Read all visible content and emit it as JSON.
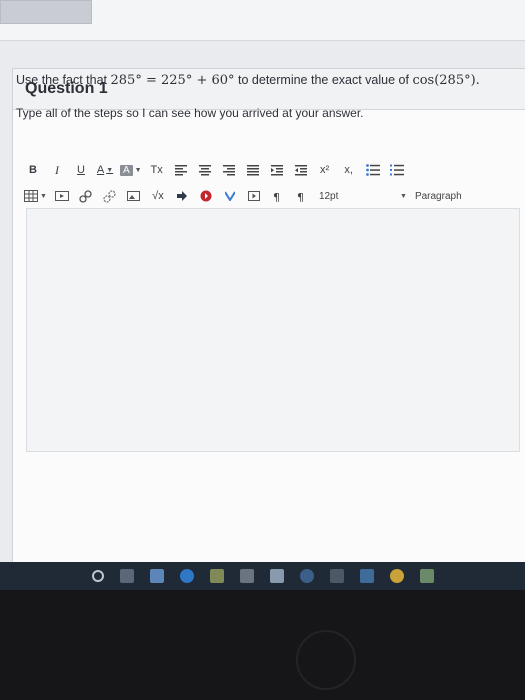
{
  "question": {
    "title": "Question 1",
    "line1_prefix": "Use the fact that ",
    "line1_eq_a": "285°",
    "line1_eq_op1": " = ",
    "line1_eq_b": "225°",
    "line1_eq_op2": " + ",
    "line1_eq_c": "60°",
    "line1_middle": " to determine the exact value of ",
    "line1_func": "cos(285°).",
    "line2": "Type all of the steps so I can see how you arrived at your answer."
  },
  "toolbar": {
    "bold": "B",
    "italic": "I",
    "underline": "U",
    "font_color": "A",
    "highlight": "A",
    "clear_format": "Tx",
    "superscript": "x²",
    "subscript": "x,",
    "font_size": "12pt",
    "block_format": "Paragraph",
    "sqrt": "√x"
  },
  "colors": {
    "accent_blue": "#3b7ad6",
    "taskbar": "#1f2a36"
  }
}
